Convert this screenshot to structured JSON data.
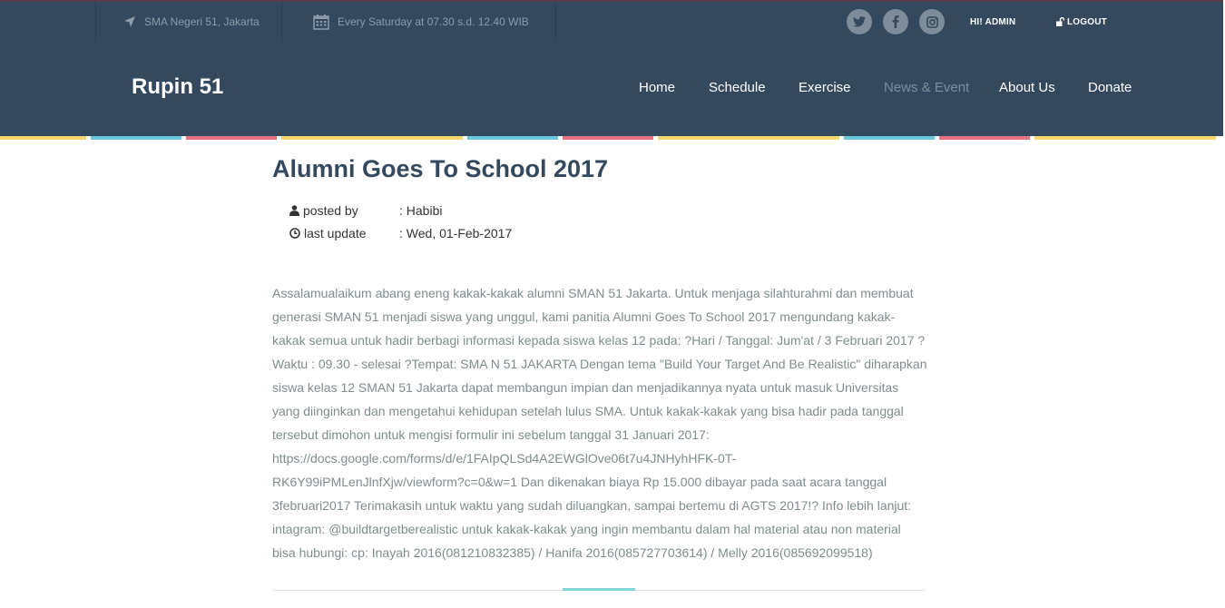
{
  "topbar": {
    "location": "SMA Negeri 51, Jakarta",
    "schedule": "Every Saturday at 07.30 s.d. 12.40 WIB",
    "location_icon": "location-arrow-icon",
    "schedule_icon": "calendar-icon",
    "social": [
      "twitter-icon",
      "facebook-icon",
      "instagram-icon"
    ],
    "greeting": "HI! ADMIN",
    "logout": "LOGOUT"
  },
  "header": {
    "brand": "Rupin 51",
    "nav": {
      "home": "Home",
      "schedule": "Schedule",
      "exercise": "Exercise",
      "news": "News & Event",
      "about": "About Us",
      "donate": "Donate"
    },
    "active_item": "News & Event"
  },
  "stripe_colors": [
    "#f5d76e",
    "#6dc7dc",
    "#e8707f"
  ],
  "post": {
    "title": "Alumni Goes To School 2017",
    "posted_by_label": "posted by",
    "posted_by_value": ": Habibi",
    "last_update_label": "last update",
    "last_update_value": ": Wed, 01-Feb-2017",
    "body": "Assalamualaikum abang eneng kakak-kakak alumni SMAN 51 Jakarta. Untuk menjaga silahturahmi dan membuat generasi SMAN 51 menjadi siswa yang unggul, kami panitia Alumni Goes To School 2017 mengundang kakak-kakak semua untuk hadir berbagi informasi kepada siswa kelas 12 pada: ?Hari / Tanggal: Jum'at / 3 Februari 2017 ?Waktu : 09.30 - selesai ?Tempat: SMA N 51 JAKARTA Dengan tema \"Build Your Target And Be Realistic\" diharapkan siswa kelas 12 SMAN 51 Jakarta dapat membangun impian dan menjadikannya nyata untuk masuk Universitas yang diinginkan dan mengetahui kehidupan setelah lulus SMA. Untuk kakak-kakak yang bisa hadir pada tanggal tersebut dimohon untuk mengisi formulir ini sebelum tanggal 31 Januari 2017: https://docs.google.com/forms/d/e/1FAIpQLSd4A2EWGlOve06t7u4JNHyhHFK-0T-RK6Y99iPMLenJlnfXjw/viewform?c=0&w=1 Dan dikenakan biaya Rp 15.000 dibayar pada saat acara tanggal 3februari2017 Terimakasih untuk waktu yang sudah diluangkan, sampai bertemu di AGTS 2017!? Info lebih lanjut: intagram: @buildtargetberealistic untuk kakak-kakak yang ingin membantu dalam hal material atau non material bisa hubungi: cp: Inayah 2016(081210832385) / Hanifa 2016(085727703614) / Melly 2016(085692099518)"
  }
}
